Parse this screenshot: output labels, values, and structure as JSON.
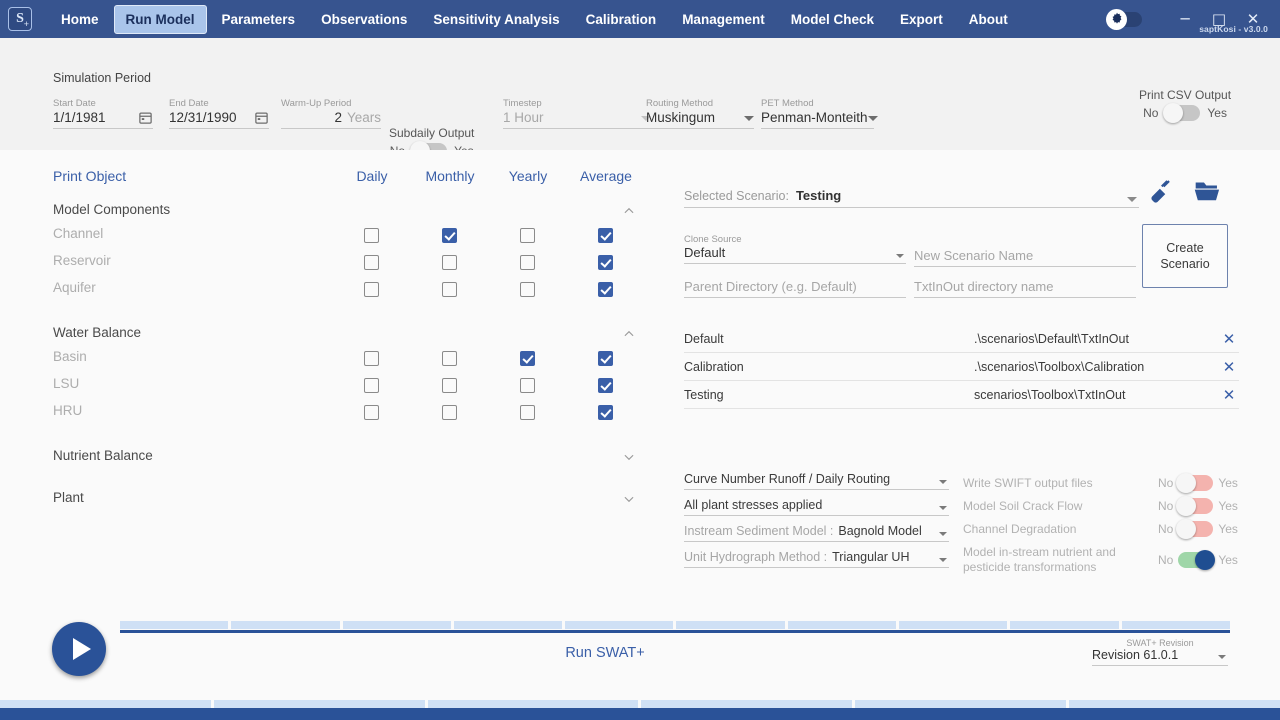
{
  "header": {
    "logo_text": "S",
    "logo_plus": "+",
    "nav": [
      {
        "label": "Home",
        "active": false
      },
      {
        "label": "Run Model",
        "active": true
      },
      {
        "label": "Parameters",
        "active": false
      },
      {
        "label": "Observations",
        "active": false
      },
      {
        "label": "Sensitivity Analysis",
        "active": false
      },
      {
        "label": "Calibration",
        "active": false
      },
      {
        "label": "Management",
        "active": false
      },
      {
        "label": "Model Check",
        "active": false
      },
      {
        "label": "Export",
        "active": false
      },
      {
        "label": "About",
        "active": false
      }
    ],
    "minimize": "─",
    "maximize": "□",
    "close": "✕",
    "project_name": "saptKosi",
    "version": "- v3.0.0"
  },
  "simulation": {
    "title": "Simulation Period",
    "start_date": {
      "label": "Start Date",
      "value": "1/1/1981"
    },
    "end_date": {
      "label": "End Date",
      "value": "12/31/1990"
    },
    "warmup": {
      "label": "Warm-Up Period",
      "value": "2",
      "unit": "Years"
    },
    "subdaily": {
      "title": "Subdaily Output",
      "off": "No",
      "on": "Yes",
      "state": false
    },
    "timestep": {
      "label": "Timestep",
      "value": "1 Hour",
      "disabled": true
    },
    "routing": {
      "label": "Routing Method",
      "value": "Muskingum"
    },
    "pet": {
      "label": "PET Method",
      "value": "Penman-Monteith"
    },
    "print_csv": {
      "title": "Print CSV Output",
      "off": "No",
      "on": "Yes",
      "state": false
    }
  },
  "print_object": {
    "title": "Print Object",
    "columns": [
      "Daily",
      "Monthly",
      "Yearly",
      "Average"
    ],
    "groups": [
      {
        "name": "Model Components",
        "expanded": true,
        "rows": [
          {
            "label": "Channel",
            "checks": [
              false,
              true,
              false,
              true
            ]
          },
          {
            "label": "Reservoir",
            "checks": [
              false,
              false,
              false,
              true
            ]
          },
          {
            "label": "Aquifer",
            "checks": [
              false,
              false,
              false,
              true
            ]
          }
        ]
      },
      {
        "name": "Water Balance",
        "expanded": true,
        "rows": [
          {
            "label": "Basin",
            "checks": [
              false,
              false,
              true,
              true
            ]
          },
          {
            "label": "LSU",
            "checks": [
              false,
              false,
              false,
              true
            ]
          },
          {
            "label": "HRU",
            "checks": [
              false,
              false,
              false,
              true
            ]
          }
        ]
      },
      {
        "name": "Nutrient Balance",
        "expanded": false,
        "rows": []
      },
      {
        "name": "Plant",
        "expanded": false,
        "rows": []
      }
    ]
  },
  "scenario": {
    "selected_label": "Selected Scenario:",
    "selected_value": "Testing",
    "clean_icon": "broom-icon",
    "open_icon": "folder-icon",
    "clone_source": {
      "label": "Clone Source",
      "value": "Default"
    },
    "new_name_placeholder": "New Scenario Name",
    "parent_dir_placeholder": "Parent Directory (e.g. Default)",
    "txtinout_placeholder": "TxtInOut directory name",
    "create_button": "Create\nScenario",
    "create_button_line1": "Create",
    "create_button_line2": "Scenario",
    "rows": [
      {
        "name": "Default",
        "path": ".\\scenarios\\Default\\TxtInOut",
        "remove": "✕"
      },
      {
        "name": "Calibration",
        "path": ".\\scenarios\\Toolbox\\Calibration",
        "remove": "✕"
      },
      {
        "name": "Testing",
        "path": "scenarios\\Toolbox\\TxtInOut",
        "remove": "✕"
      }
    ]
  },
  "options": {
    "selects": [
      {
        "label": "",
        "value": "Curve Number Runoff / Daily Routing",
        "disabled": false
      },
      {
        "label": "",
        "value": "All plant stresses applied",
        "disabled": false
      },
      {
        "label": "Instream Sediment Model  :",
        "value": "Bagnold Model",
        "disabled": true
      },
      {
        "label": "Unit Hydrograph Method   :",
        "value": "Triangular UH",
        "disabled": true
      }
    ],
    "switches": [
      {
        "label": "Write SWIFT output files",
        "off": "No",
        "on": "Yes",
        "state": false
      },
      {
        "label": "Model Soil Crack Flow",
        "off": "No",
        "on": "Yes",
        "state": false
      },
      {
        "label": "Channel Degradation",
        "off": "No",
        "on": "Yes",
        "state": false
      },
      {
        "label": "Model in-stream nutrient and pesticide transformations",
        "off": "No",
        "on": "Yes",
        "state": true
      }
    ]
  },
  "run": {
    "play_icon": "play-icon",
    "label": "Run SWAT+",
    "revision_label": "SWAT+ Revision",
    "revision_value": "Revision 61.0.1"
  },
  "colors": {
    "brand_blue": "#37548f",
    "accent_blue": "#3a5fa8",
    "toggle_on": "#9fd6a8",
    "toggle_off": "#f4b3ae"
  }
}
